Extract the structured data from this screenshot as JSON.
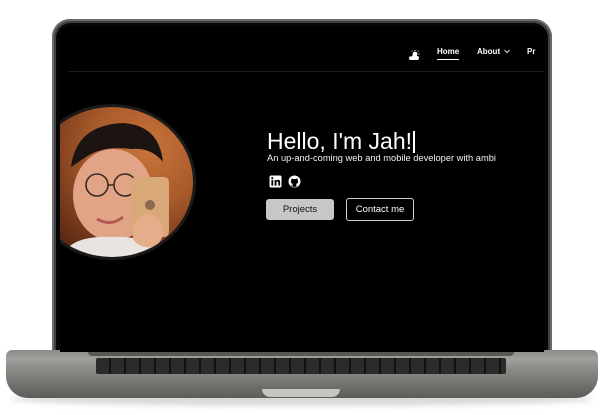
{
  "nav": {
    "theme_icon": "sun-cloud-icon",
    "items": [
      {
        "label": "Home"
      },
      {
        "label": "About"
      },
      {
        "label": "Pr"
      }
    ],
    "about_chevron": "chevron-down-icon"
  },
  "hero": {
    "greeting": "Hello, I'm Jah!",
    "tagline": "An up-and-coming web and mobile developer with ambi",
    "social": [
      {
        "icon": "linkedin-icon"
      },
      {
        "icon": "github-icon"
      }
    ],
    "primary_button": "Projects",
    "secondary_button": "Contact me"
  },
  "colors": {
    "background": "#000000",
    "text": "#ffffff",
    "primary_button_bg": "#c7c7c7",
    "laptop_body": "#8a8a88"
  }
}
